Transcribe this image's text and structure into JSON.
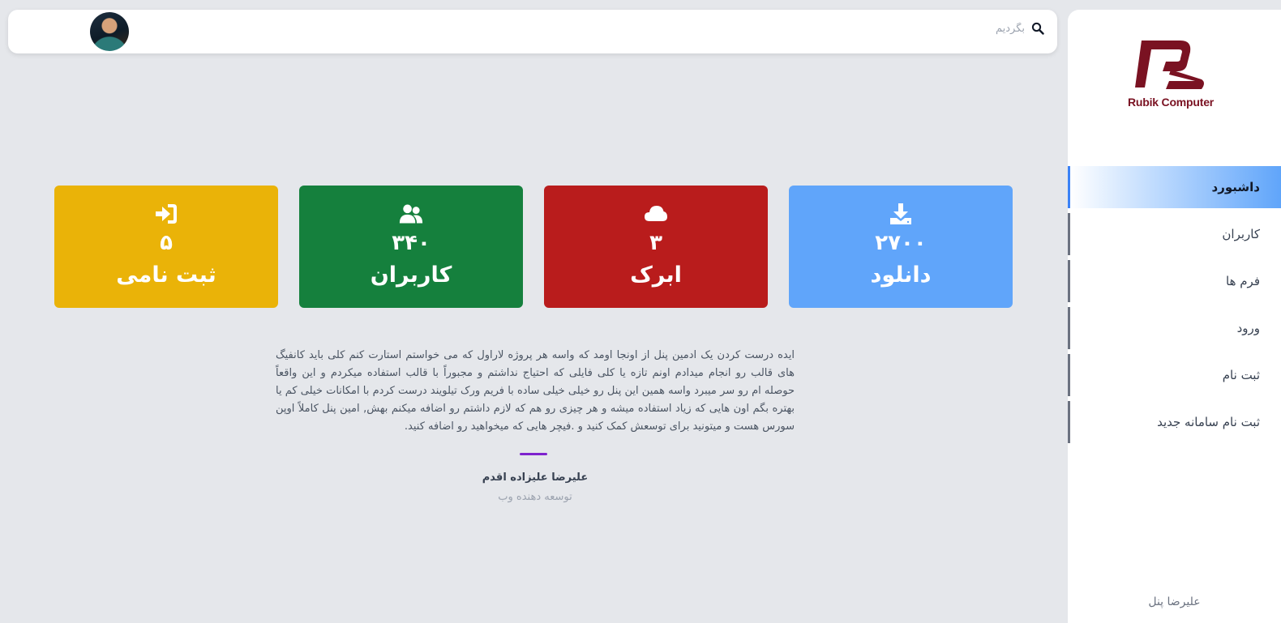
{
  "brand": {
    "name": "Rubik Computer",
    "accent": "#7a1222"
  },
  "search": {
    "placeholder": "بگردیم",
    "icon": "search-icon"
  },
  "sidebar": {
    "items": [
      {
        "label": "داشبورد",
        "active": true
      },
      {
        "label": "کاربران",
        "active": false
      },
      {
        "label": "فرم ها",
        "active": false
      },
      {
        "label": "ورود",
        "active": false
      },
      {
        "label": "ثبت نام",
        "active": false
      },
      {
        "label": "ثبت نام سامانه جدید",
        "active": false
      }
    ],
    "footer": "علیرضا پنل"
  },
  "cards": [
    {
      "value": "۲۷۰۰",
      "label": "دانلود",
      "icon": "download-icon",
      "color": "#60a5fa"
    },
    {
      "value": "۳",
      "label": "ابرک",
      "icon": "cloud-icon",
      "color": "#b91c1c"
    },
    {
      "value": "۳۴۰",
      "label": "کاربران",
      "icon": "users-icon",
      "color": "#15803d"
    },
    {
      "value": "۵",
      "label": "ثبت نامی",
      "icon": "sign-in-icon",
      "color": "#eab308"
    }
  ],
  "quote": {
    "text": "ایده درست کردن یک ادمین پنل از اونجا اومد که واسه هر پروژه لاراول که می خواستم استارت کنم کلی باید کانفیگ های قالب رو انجام میدادم اونم تازه یا کلی فایلی که احتیاج نداشتم و مجبوراً با قالب استفاده میکردم و این واقعاً حوصله ام رو سر میبرد واسه همین این پنل رو خیلی خیلی ساده با فریم ورک تیلویند درست کردم با امکانات خیلی کم یا بهتره بگم اون هایی که زیاد استفاده میشه و هر چیزی رو هم که لازم داشتم رو اضافه میکنم بهش, امین پنل کاملاً اوپن سورس هست و میتونید برای توسعش کمک کنید و .فیچر هایی که میخواهید رو اضافه کنید.",
    "author": "علیرضا علیزاده اقدم",
    "role": "توسعه دهنده وب",
    "divider_color": "#7e22ce"
  }
}
